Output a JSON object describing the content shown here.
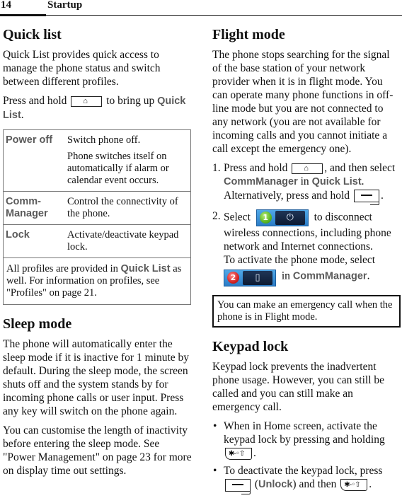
{
  "header": {
    "page_number": "14",
    "section": "Startup"
  },
  "quick_list": {
    "title": "Quick list",
    "intro": "Quick List provides quick access to manage the phone status and switch between different profiles.",
    "press_prefix": "Press and hold",
    "press_mid": "to bring up",
    "press_ui": "Quick List",
    "press_suffix": ".",
    "table": {
      "rows": [
        {
          "label": "Power off",
          "desc": [
            "Switch phone off.",
            "Phone switches itself on automatically if alarm or calendar event occurs."
          ]
        },
        {
          "label": "Comm-Manager",
          "desc": [
            "Control the connectivity of the phone."
          ]
        },
        {
          "label": "Lock",
          "desc": [
            "Activate/deactivate keypad lock."
          ]
        }
      ],
      "note_prefix": "All profiles are provided in",
      "note_ui": "Quick List",
      "note_suffix": "as well. For information on profiles, see \"Profiles\" on page 21."
    }
  },
  "sleep_mode": {
    "title": "Sleep mode",
    "paragraphs": [
      "The phone will automatically enter the sleep mode if it is inactive for 1 minute by default. During the sleep mode, the screen shuts off and the system stands by for incoming phone calls or user input. Press any key will switch on the phone again.",
      "You can customise the length of inactivity before entering the sleep mode. See \"Power Management\" on page 23 for more on display time out settings."
    ]
  },
  "flight_mode": {
    "title": "Flight mode",
    "intro": "The phone stops searching for the signal of the base station of your network provider when it is in flight mode. You can operate many phone functions in off-line mode but you are not connected to any network (you are not available for incoming calls and you cannot initiate a call except the emergency one).",
    "steps": [
      {
        "num": "1.",
        "a": "Press and hold",
        "b": ", and then select",
        "ui1": "CommManager",
        "c": "in",
        "ui2": "Quick List",
        "d": ". Alternatively, press and hold",
        "e": "."
      },
      {
        "num": "2.",
        "a": "Select",
        "b": "to disconnect wireless connections, including phone network and Internet connections.",
        "c": "To activate the phone mode, select",
        "d": "in",
        "ui": "CommManager",
        "e": "."
      }
    ],
    "toggle_on": {
      "badge": "1",
      "icon": "power-icon",
      "glyph": "⏻"
    },
    "toggle_off": {
      "badge": "2",
      "icon": "phone-icon",
      "glyph": "▯"
    },
    "note": "You can make an emergency call when the phone is in Flight mode."
  },
  "keypad_lock": {
    "title": "Keypad lock",
    "intro": "Keypad lock prevents the inadvertent phone usage. However, you can still be called and you can still make an emergency call.",
    "bullets": [
      {
        "a": "When in Home screen, activate the keypad lock by pressing and holding",
        "b": "."
      },
      {
        "a": "To deactivate the keypad lock, press",
        "ui": "Unlock",
        "b": "and then",
        "c": "."
      }
    ]
  },
  "keys": {
    "home_glyph": "⌂",
    "star_glyph": "✱-◦⇧"
  }
}
